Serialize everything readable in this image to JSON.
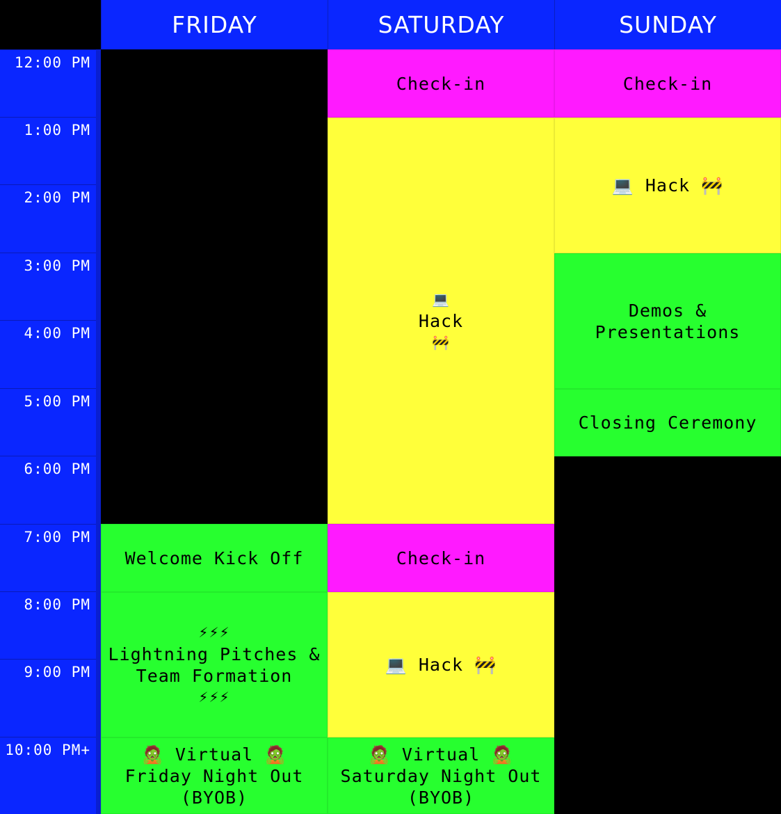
{
  "days": [
    "FRIDAY",
    "SATURDAY",
    "SUNDAY"
  ],
  "times": [
    "12:00 PM",
    "1:00 PM",
    "2:00 PM",
    "3:00 PM",
    "4:00 PM",
    "5:00 PM",
    "6:00 PM",
    "7:00 PM",
    "8:00 PM",
    "9:00 PM",
    "10:00 PM+"
  ],
  "colors": {
    "header": "#0a26ff",
    "checkin": "#ff1aff",
    "hack": "#ffff3a",
    "event": "#27ff2f",
    "empty": "#000000"
  },
  "friday": {
    "welcome": "Welcome Kick Off",
    "lightning_top": "⚡⚡⚡",
    "lightning_1": "Lightning Pitches &",
    "lightning_2": "Team Formation",
    "lightning_bottom": "⚡⚡⚡",
    "night_1": "🧟 Virtual 🧟",
    "night_2": "Friday Night Out",
    "night_3": "(BYOB)"
  },
  "saturday": {
    "checkin_1": "Check-in",
    "hack_top": "💻",
    "hack_mid": "Hack",
    "hack_bottom": "🚧",
    "checkin_2": "Check-in",
    "hack2": "💻 Hack 🚧",
    "night_1": "🧟 Virtual 🧟",
    "night_2": "Saturday Night Out",
    "night_3": "(BYOB)"
  },
  "sunday": {
    "checkin": "Check-in",
    "hack": "💻 Hack 🚧",
    "demos_1": "Demos &",
    "demos_2": "Presentations",
    "closing": "Closing Ceremony"
  }
}
